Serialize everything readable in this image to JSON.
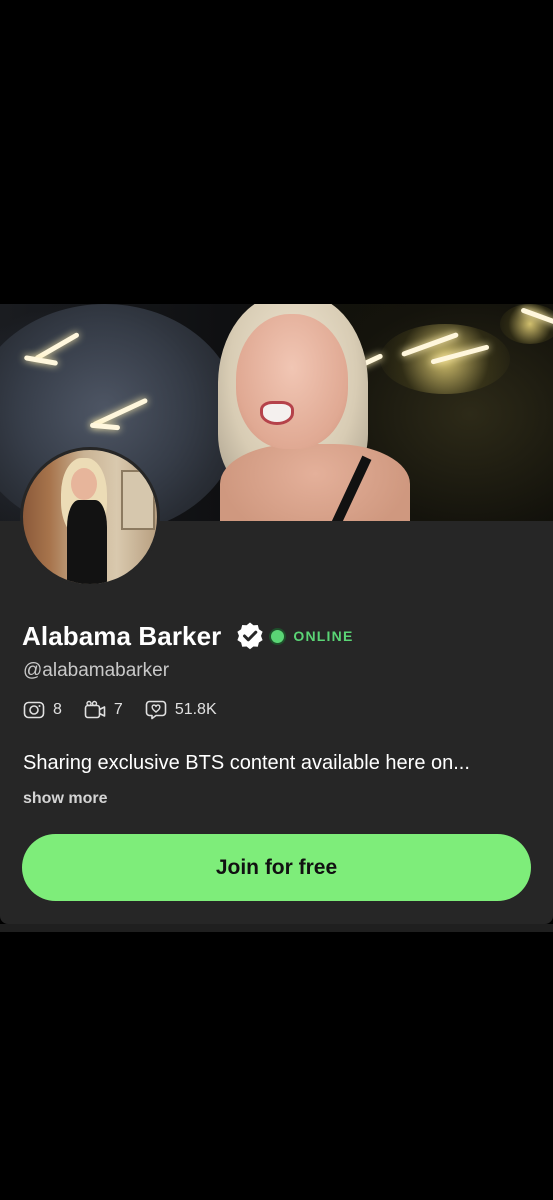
{
  "profile": {
    "name": "Alabama Barker",
    "status": "ONLINE",
    "handle": "@alabamabarker",
    "bio": "Sharing exclusive BTS content available here on...",
    "show_more": "show more"
  },
  "stats": {
    "photos": "8",
    "videos": "7",
    "likes": "51.8K"
  },
  "actions": {
    "join_label": "Join for free"
  },
  "icons": {
    "verified": "verified-badge-icon",
    "photos": "camera-icon",
    "videos": "video-camera-icon",
    "likes": "heart-bubble-icon"
  },
  "colors": {
    "accent": "#7eed7a",
    "online": "#5ad575",
    "card_bg": "#262626",
    "page_bg": "#000000"
  }
}
